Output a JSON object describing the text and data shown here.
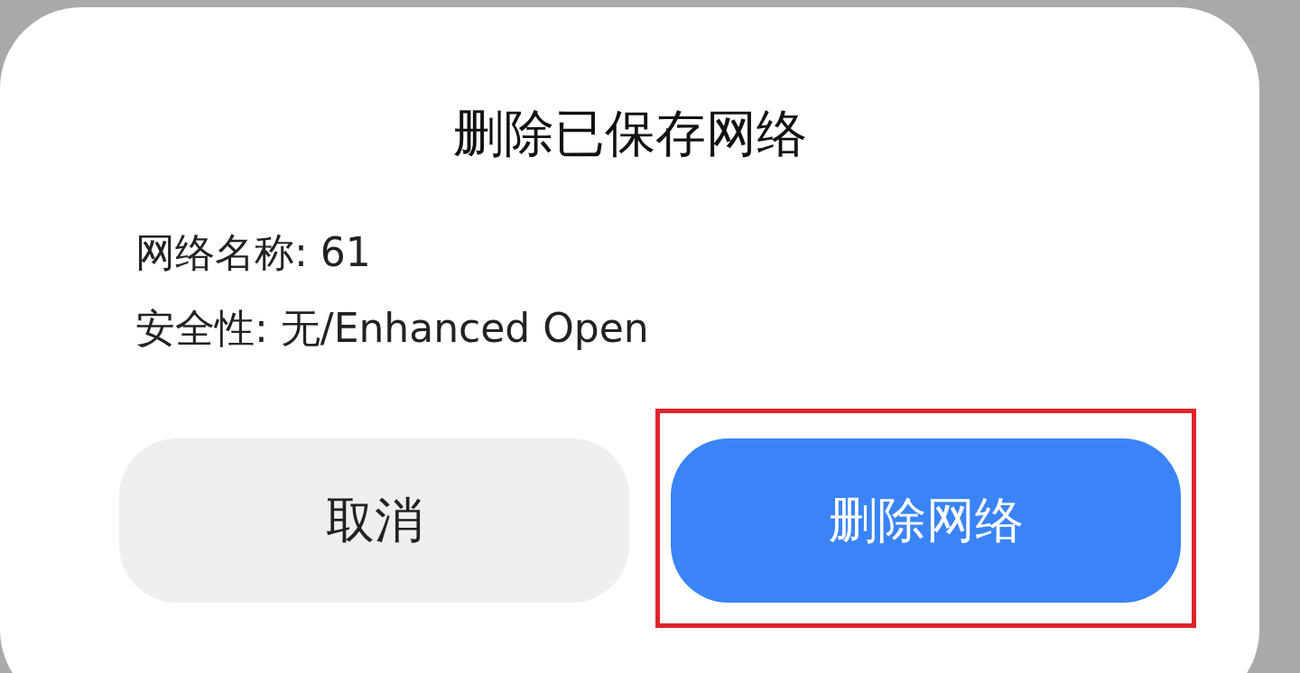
{
  "dialog": {
    "title": "删除已保存网络",
    "details": [
      "网络名称: 61",
      "安全性: 无/Enhanced Open"
    ],
    "buttons": [
      {
        "label": "取消",
        "kind": "secondary",
        "highlighted": false
      },
      {
        "label": "删除网络",
        "kind": "primary",
        "highlighted": true
      }
    ]
  }
}
